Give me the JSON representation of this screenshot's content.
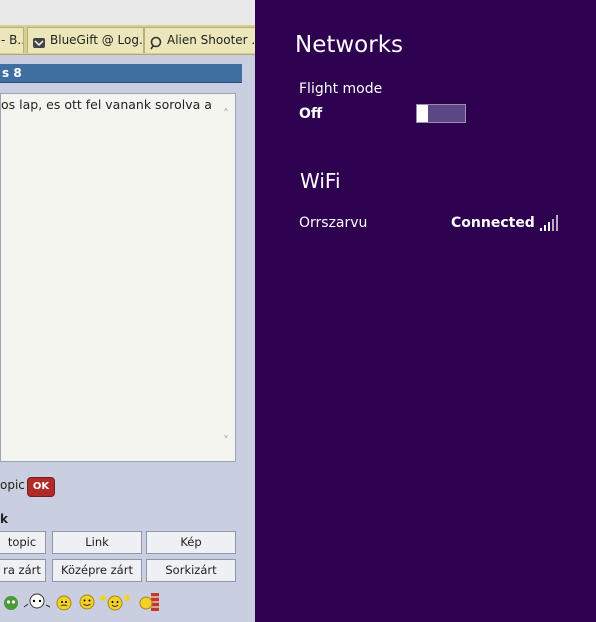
{
  "browser": {
    "tabs": [
      {
        "label": "- B...",
        "icon": "page-icon"
      },
      {
        "label": "BlueGift @ Log...",
        "icon": "bluegift-icon"
      },
      {
        "label": "Alien Shooter ...",
        "icon": "search-bubble-icon"
      }
    ],
    "panel_title": "s 8",
    "editor_text": "os lap, es ott fel vanank sorolva a",
    "topic_label": "opic",
    "ok_label": "OK",
    "section_label": "k",
    "format_buttons_row1": [
      "topic",
      "Link",
      "Kép"
    ],
    "format_buttons_row2": [
      "ra zárt",
      "Középre zárt",
      "Sorkizárt"
    ]
  },
  "networks": {
    "title": "Networks",
    "flight_mode_label": "Flight mode",
    "flight_mode_state": "Off",
    "flight_mode_on": false,
    "wifi_title": "WiFi",
    "network_name": "Orrszarvu",
    "network_status": "Connected",
    "signal_bars": 5,
    "colors": {
      "background": "#2e0050",
      "toggle_track": "#5d4685"
    }
  }
}
